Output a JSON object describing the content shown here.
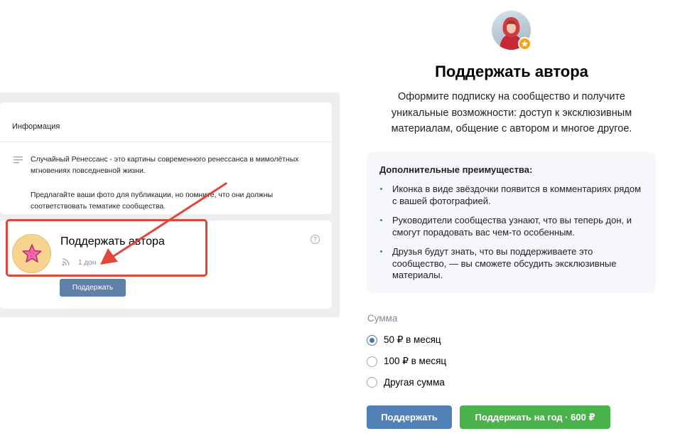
{
  "left_screenshot": {
    "info_card": {
      "title": "Информация",
      "description": "Случайный Ренессанс - это картины современного ренессанса в мимолётных мгновениях повседневной жизни.",
      "note": "Предлагайте ваши фото для публикации, но помните, что они должны соответствовать тематике сообщества."
    },
    "don_card": {
      "title": "Поддержать автора",
      "count": "1 дон",
      "button_label": "Поддержать",
      "help_glyph": "?"
    },
    "annotation": {
      "color": "#d94a3a"
    }
  },
  "panel": {
    "title": "Поддержать автора",
    "description": "Оформите подписку на сообщество и получите уникальные возможности: доступ к эксклюзивным материалам, общение с автором и многое другое.",
    "benefits": {
      "title": "Дополнительные преимущества:",
      "items": [
        "Иконка в виде звёздочки появится в комментариях рядом с вашей фотографией.",
        "Руководители сообщества узнают, что вы теперь дон, и смогут порадовать вас чем-то особенным.",
        "Друзья будут знать, что вы поддерживаете это сообщество, — вы сможете обсудить эксклюзивные материалы."
      ]
    },
    "sum_label": "Сумма",
    "options": [
      {
        "label": "50 ₽ в месяц",
        "selected": true
      },
      {
        "label": "100 ₽ в месяц",
        "selected": false
      },
      {
        "label": "Другая сумма",
        "selected": false
      }
    ],
    "buttons": {
      "support": "Поддержать",
      "support_year": "Поддержать на год · 600 ₽"
    }
  },
  "colors": {
    "vk_blue": "#5181b8",
    "green": "#4bb34b",
    "badge_orange": "#ffa000",
    "muted_text": "#818c99"
  },
  "icons": [
    "lines-icon",
    "star-icon",
    "rss-icon",
    "help-icon",
    "star-badge-icon",
    "author-avatar"
  ]
}
